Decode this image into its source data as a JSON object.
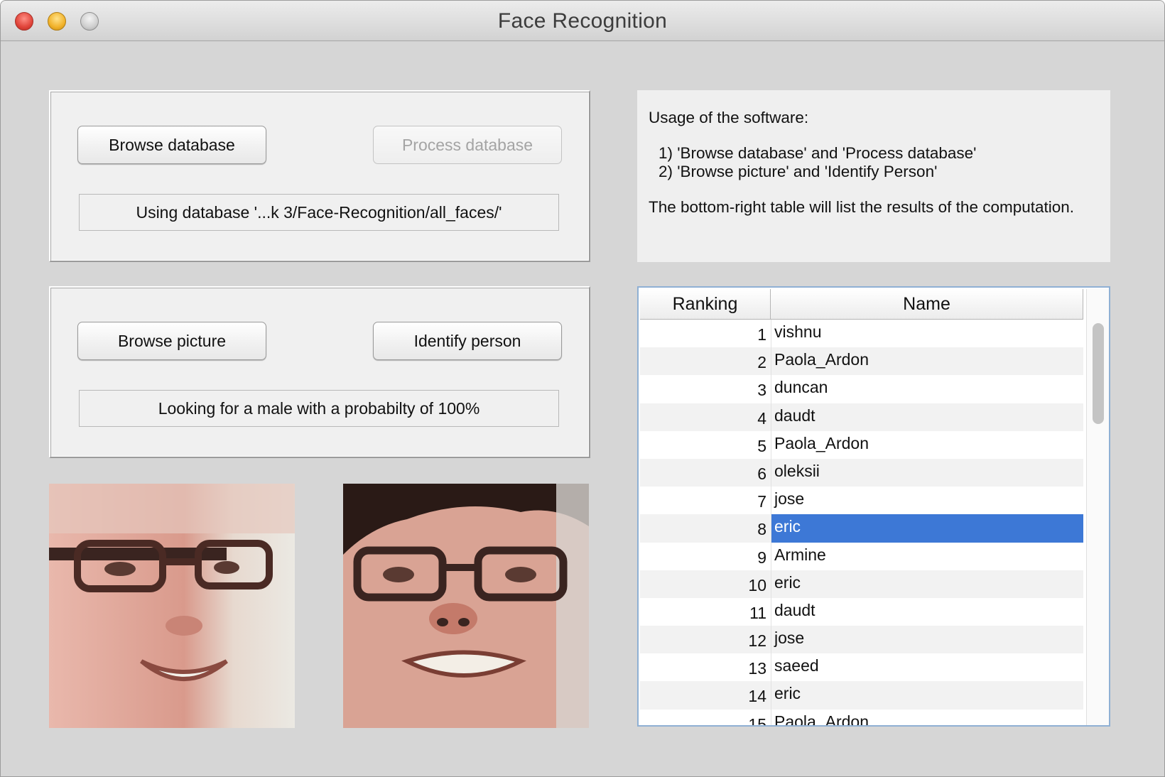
{
  "window": {
    "title": "Face Recognition"
  },
  "database_panel": {
    "browse_label": "Browse database",
    "process_label": "Process database",
    "status": "Using database '...k 3/Face-Recognition/all_faces/'"
  },
  "picture_panel": {
    "browse_label": "Browse picture",
    "identify_label": "Identify person",
    "status": "Looking for a male with a probabilty of 100%"
  },
  "usage": {
    "heading": "Usage of the software:",
    "step1": "1) 'Browse database' and 'Process database'",
    "step2": "2) 'Browse picture' and 'Identify Person'",
    "note": "The bottom-right table will list the results of the computation."
  },
  "results": {
    "headers": {
      "rank": "Ranking",
      "name": "Name"
    },
    "rows": [
      {
        "rank": "1",
        "name": "vishnu"
      },
      {
        "rank": "2",
        "name": "Paola_Ardon"
      },
      {
        "rank": "3",
        "name": "duncan"
      },
      {
        "rank": "4",
        "name": "daudt"
      },
      {
        "rank": "5",
        "name": "Paola_Ardon"
      },
      {
        "rank": "6",
        "name": "oleksii"
      },
      {
        "rank": "7",
        "name": "jose"
      },
      {
        "rank": "8",
        "name": "eric"
      },
      {
        "rank": "9",
        "name": "Armine"
      },
      {
        "rank": "10",
        "name": "eric"
      },
      {
        "rank": "11",
        "name": "daudt"
      },
      {
        "rank": "12",
        "name": "jose"
      },
      {
        "rank": "13",
        "name": "saeed"
      },
      {
        "rank": "14",
        "name": "eric"
      },
      {
        "rank": "15",
        "name": "Paola_Ardon"
      }
    ],
    "selected_rank": "8",
    "selection_color": "#3d78d6"
  },
  "images": {
    "query_face": "face-photo-icon",
    "match_face": "face-photo-icon"
  }
}
